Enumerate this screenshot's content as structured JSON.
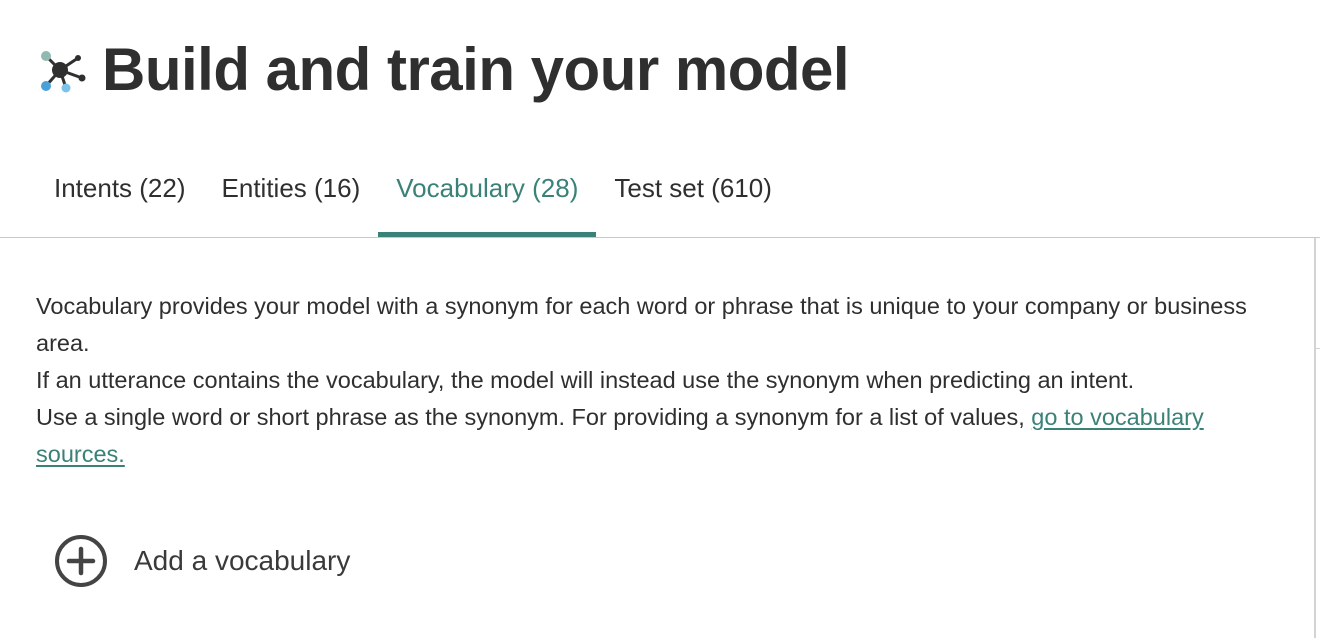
{
  "header": {
    "title": "Build and train your model",
    "logo_icon": "model-network-icon"
  },
  "tabs": [
    {
      "label": "Intents (22)",
      "active": false
    },
    {
      "label": "Entities (16)",
      "active": false
    },
    {
      "label": "Vocabulary (28)",
      "active": true
    },
    {
      "label": "Test set (610)",
      "active": false
    }
  ],
  "description": {
    "line1": "Vocabulary provides your model with a synonym for each word or phrase that is unique to your company or business area.",
    "line2": "If an utterance contains the vocabulary, the model will instead use the synonym when predicting an intent.",
    "line3_text": "Use a single word or short phrase as the synonym. For providing a synonym for a list of values, ",
    "line3_link": "go to vocabulary sources."
  },
  "add_vocabulary": {
    "label": "Add a vocabulary",
    "icon": "plus-circle-icon"
  },
  "colors": {
    "accent": "#3a8177",
    "text": "#2f2f2f",
    "divider": "#c9c9c9"
  }
}
